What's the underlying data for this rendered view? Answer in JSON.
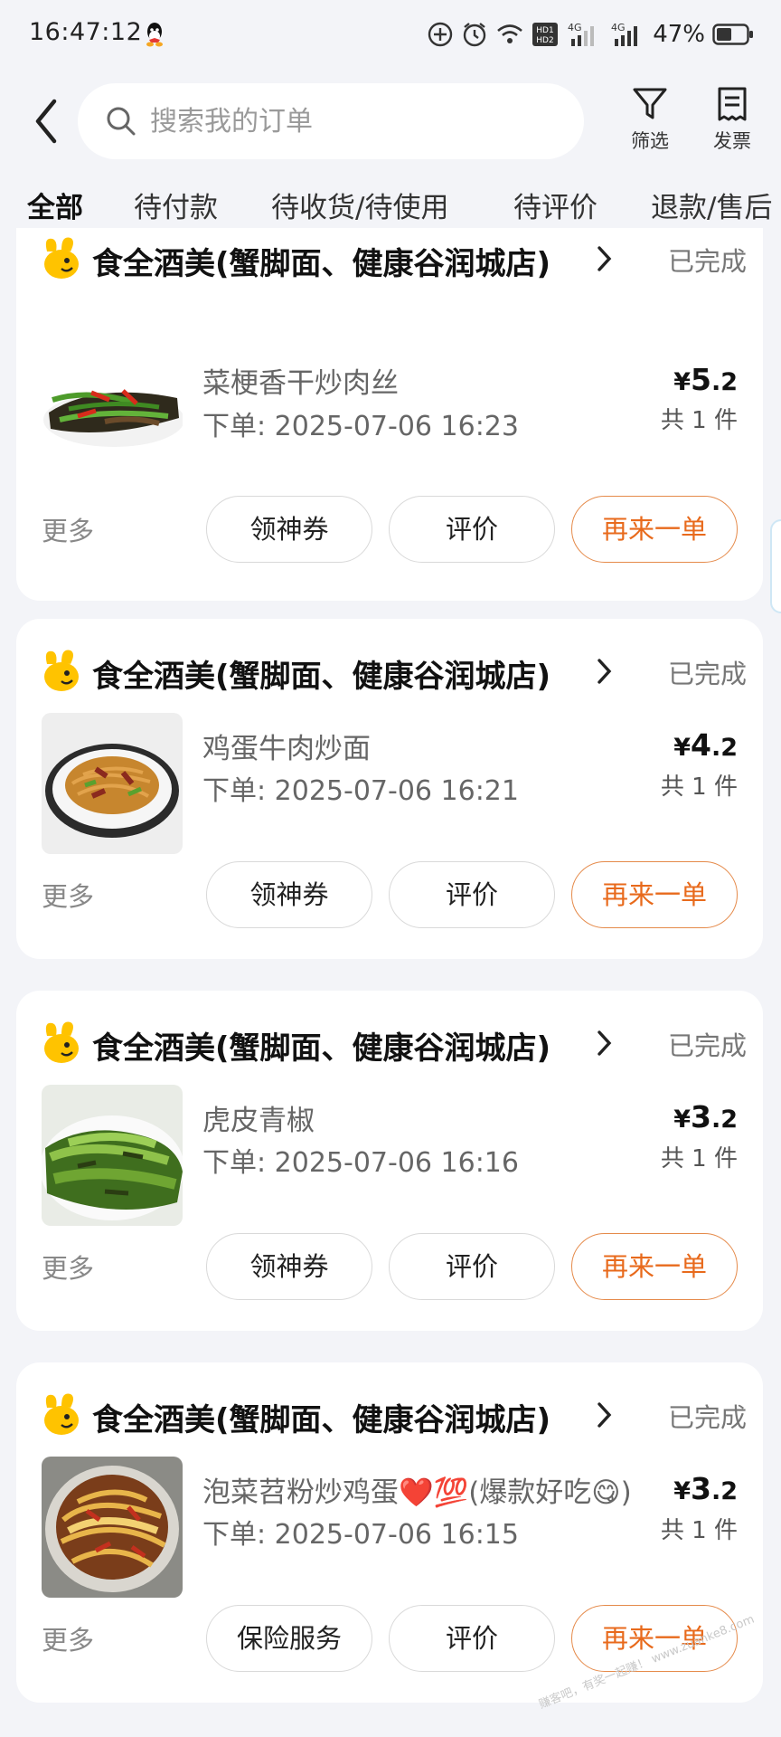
{
  "status_bar": {
    "time": "16:47:12",
    "network_a": "4G",
    "network_b": "4G",
    "hd_badge": "HD1 HD2",
    "battery": "47%"
  },
  "header": {
    "search_placeholder": "搜索我的订单",
    "filter_label": "筛选",
    "invoice_label": "发票"
  },
  "tabs": [
    "全部",
    "待付款",
    "待收货/待使用",
    "待评价",
    "退款/售后"
  ],
  "active_tab": "全部",
  "colors": {
    "accent_yellow": "#ffc300",
    "reorder_orange": "#e86a1c",
    "background": "#f3f4f8"
  },
  "orders": [
    {
      "shop": "食全酒美(蟹脚面、健康谷润城店)",
      "status": "已完成",
      "item": "菜梗香干炒肉丝",
      "time": "下单: 2025-07-06 16:23",
      "price_symbol": "¥",
      "price_int": "5",
      "price_dec": ".2",
      "quantity": "共 1 件",
      "more": "更多",
      "buttons": [
        "领神券",
        "评价",
        "再来一单"
      ]
    },
    {
      "shop": "食全酒美(蟹脚面、健康谷润城店)",
      "status": "已完成",
      "item": "鸡蛋牛肉炒面",
      "time": "下单: 2025-07-06 16:21",
      "price_symbol": "¥",
      "price_int": "4",
      "price_dec": ".2",
      "quantity": "共 1 件",
      "more": "更多",
      "buttons": [
        "领神券",
        "评价",
        "再来一单"
      ]
    },
    {
      "shop": "食全酒美(蟹脚面、健康谷润城店)",
      "status": "已完成",
      "item": "虎皮青椒",
      "time": "下单: 2025-07-06 16:16",
      "price_symbol": "¥",
      "price_int": "3",
      "price_dec": ".2",
      "quantity": "共 1 件",
      "more": "更多",
      "buttons": [
        "领神券",
        "评价",
        "再来一单"
      ]
    },
    {
      "shop": "食全酒美(蟹脚面、健康谷润城店)",
      "status": "已完成",
      "item": "泡菜苕粉炒鸡蛋❤️💯(爆款好吃😋)",
      "time": "下单: 2025-07-06 16:15",
      "price_symbol": "¥",
      "price_int": "3",
      "price_dec": ".2",
      "quantity": "共 1 件",
      "more": "更多",
      "buttons": [
        "保险服务",
        "评价",
        "再来一单"
      ]
    }
  ],
  "watermark": "赚客吧，有奖一起赚！ www.zuanke8.com"
}
